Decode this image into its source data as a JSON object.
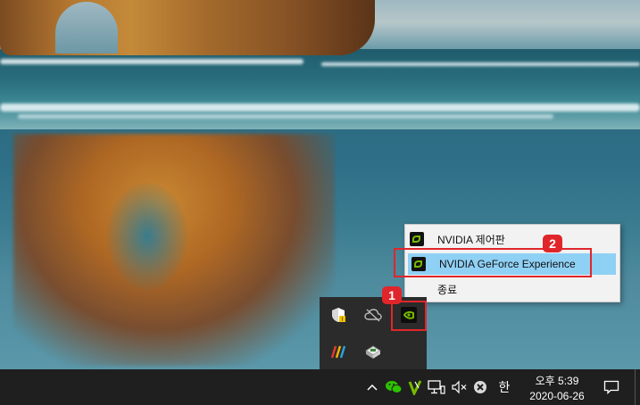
{
  "context_menu": {
    "items": [
      {
        "label": "NVIDIA 제어판",
        "icon": "nvidia-icon"
      },
      {
        "label": "NVIDIA GeForce Experience",
        "icon": "nvidia-icon",
        "highlighted": true
      },
      {
        "label": "종료"
      }
    ]
  },
  "tray_overflow": {
    "icons": [
      "security-shield-icon",
      "cloud-offline-icon",
      "nvidia-icon",
      "stripes-app-icon",
      "puzzle-app-icon"
    ]
  },
  "annotations": {
    "badge_1": "1",
    "badge_2": "2",
    "color": "#e0262b"
  },
  "taskbar": {
    "chevron": "^",
    "ime_label": "한",
    "clock": {
      "time": "오후 5:39",
      "date": "2020-06-26"
    },
    "icons": [
      "chevron-up-icon",
      "wechat-icon",
      "nvidia-icon",
      "network-icon",
      "volume-muted-icon",
      "stop-icon",
      "notification-icon"
    ]
  },
  "colors": {
    "menu_highlight": "#8fd0f5",
    "taskbar_bg": "#1f1f1f",
    "nvidia_green": "#76b900"
  }
}
